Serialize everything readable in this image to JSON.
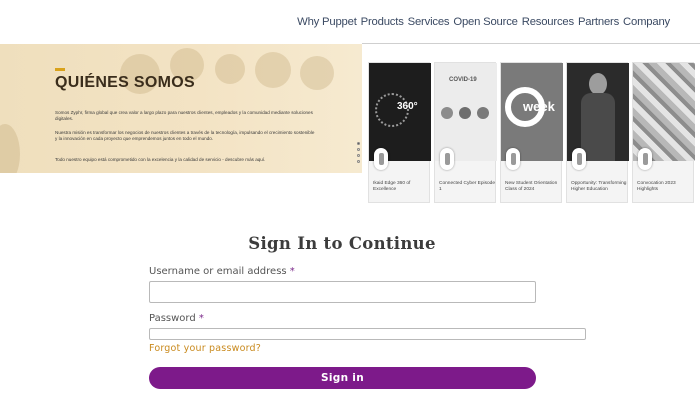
{
  "nav": {
    "links": [
      "Why Puppet",
      "Products",
      "Services",
      "Open Source",
      "Resources",
      "Partners",
      "Company"
    ]
  },
  "about": {
    "title": "QUIÉNES SOMOS",
    "paragraphs": [
      "Somos Zyphr, firma global que crea valor a largo plazo para nuestros clientes, empleados y la comunidad mediante soluciones digitales.",
      "Nuestra misión es transformar los negocios de nuestros clientes a través de la tecnología, impulsando el crecimiento sostenible y la innovación en cada proyecto que emprendemos juntos en todo el mundo.",
      "Todo nuestro equipo está comprometido con la excelencia y la calidad de servicio - descubre más aquí."
    ]
  },
  "videos": [
    {
      "caption": "Ikaid Edge 360 of Excellence",
      "thumb_text": "360°"
    },
    {
      "caption": "Connected Cyber Episode 1",
      "thumb_text": "COVID-19"
    },
    {
      "caption": "New Student Orientation Class of 2024",
      "thumb_text": "week"
    },
    {
      "caption": "Opportunity: Transforming Higher Education",
      "thumb_text": ""
    },
    {
      "caption": "Convocation 2023 Highlights",
      "thumb_text": ""
    }
  ],
  "form": {
    "title": "Sign In to Continue",
    "username_label": "Username or email address",
    "password_label": "Password",
    "required_mark": "*",
    "username_value": "",
    "password_value": "",
    "forgot_link": "Forgot your password?",
    "submit_label": "Sign in"
  },
  "colors": {
    "brand_purple": "#7d1a8a",
    "link_orange": "#c98a1e",
    "hero_accent": "#d9a21b"
  }
}
